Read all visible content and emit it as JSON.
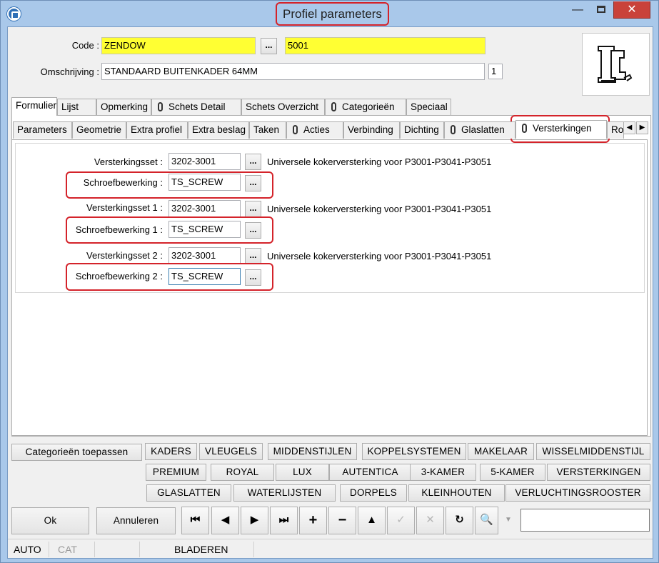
{
  "window": {
    "title": "Profiel parameters",
    "close_symbol": "✕",
    "minimize_symbol": "—"
  },
  "header": {
    "code_label": "Code :",
    "code_value": "ZENDOW",
    "code_number": "5001",
    "omschrijving_label": "Omschrijving :",
    "omschrijving_value": "STANDAARD BUITENKADER 64MM",
    "omschrijving_count": "1",
    "browse_label": "..."
  },
  "main_tabs": [
    "Formulier",
    "Lijst",
    "Opmerking",
    "Schets Detail",
    "Schets Overzicht",
    "Categorieën",
    "Speciaal"
  ],
  "sub_tabs": [
    "Parameters",
    "Geometrie",
    "Extra profiel",
    "Extra beslag",
    "Taken",
    "Acties",
    "Verbinding",
    "Dichting",
    "Glaslatten",
    "Versterkingen",
    "Ro"
  ],
  "form": {
    "rows": [
      {
        "label": "Versterkingsset :",
        "value": "3202-3001",
        "desc": "Universele kokerversterking voor P3001-P3041-P3051"
      },
      {
        "label": "Schroefbewerking :",
        "value": "TS_SCREW",
        "desc": ""
      },
      {
        "label": "Versterkingsset 1 :",
        "value": "3202-3001",
        "desc": "Universele kokerversterking voor P3001-P3041-P3051"
      },
      {
        "label": "Schroefbewerking 1 :",
        "value": "TS_SCREW",
        "desc": ""
      },
      {
        "label": "Versterkingsset 2 :",
        "value": "3202-3001",
        "desc": "Universele kokerversterking voor P3001-P3041-P3051"
      },
      {
        "label": "Schroefbewerking 2 :",
        "value": "TS_SCREW",
        "desc": ""
      }
    ]
  },
  "category_buttons": {
    "apply": "Categorieën toepassen",
    "row1": [
      "KADERS",
      "VLEUGELS",
      "MIDDENSTIJLEN",
      "KOPPELSYSTEMEN",
      "MAKELAAR",
      "WISSELMIDDENSTIJL"
    ],
    "row2": [
      "PREMIUM",
      "ROYAL",
      "LUX",
      "AUTENTICA",
      "3-KAMER",
      "5-KAMER",
      "VERSTERKINGEN"
    ],
    "row3": [
      "GLASLATTEN",
      "WATERLIJSTEN",
      "DORPELS",
      "KLEINHOUTEN",
      "VERLUCHTINGSROOSTER"
    ]
  },
  "footer": {
    "ok_label": "Ok",
    "cancel_label": "Annuleren",
    "nav_icons": [
      "first-record-icon",
      "previous-record-icon",
      "next-record-icon",
      "last-record-icon",
      "add-record-icon",
      "delete-record-icon",
      "up-icon",
      "confirm-icon",
      "cancel-edit-icon",
      "refresh-icon",
      "search-icon"
    ],
    "search_value": ""
  },
  "status_bar": {
    "mode": "AUTO",
    "cat": "CAT",
    "state": "BLADEREN"
  },
  "colors": {
    "titlebar": "#a9c8ea",
    "highlight": "#d4232a",
    "yellow_field": "#ffff33",
    "close_button": "#c9423a"
  }
}
